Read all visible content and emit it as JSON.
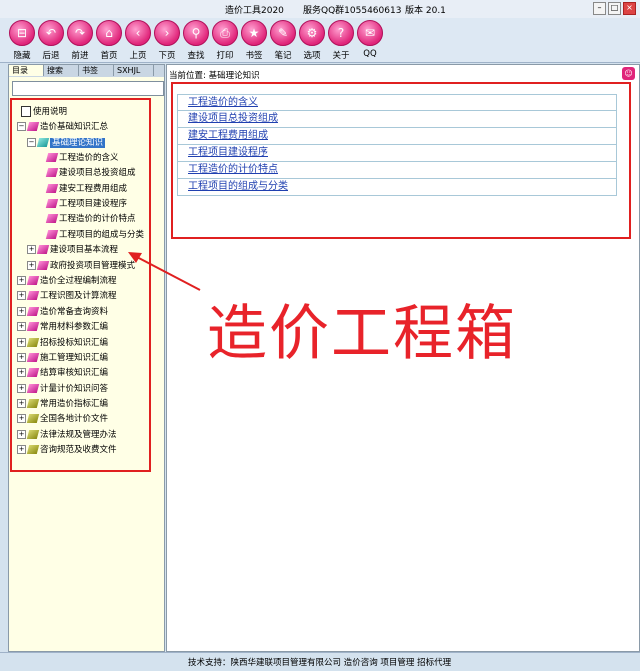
{
  "window": {
    "title": "造价工具2020",
    "service": "服务QQ群1055460613",
    "version": "版本 20.1"
  },
  "toolbar": {
    "buttons": [
      {
        "label": "隐藏",
        "icon": "hide-icon"
      },
      {
        "label": "后退",
        "icon": "back-icon"
      },
      {
        "label": "前进",
        "icon": "forward-icon"
      },
      {
        "label": "首页",
        "icon": "home-icon"
      },
      {
        "label": "上页",
        "icon": "prev-page-icon"
      },
      {
        "label": "下页",
        "icon": "next-page-icon"
      },
      {
        "label": "查找",
        "icon": "find-icon"
      },
      {
        "label": "打印",
        "icon": "print-icon"
      },
      {
        "label": "书签",
        "icon": "bookmark-icon"
      },
      {
        "label": "笔记",
        "icon": "note-icon"
      },
      {
        "label": "选项",
        "icon": "options-icon"
      },
      {
        "label": "关于",
        "icon": "about-icon"
      },
      {
        "label": "QQ",
        "icon": "qq-icon"
      }
    ]
  },
  "left_panel": {
    "tabs": [
      "目录",
      "搜索",
      "书签",
      "SXHJL"
    ],
    "search_value": "",
    "tree": [
      {
        "label": "使用说明",
        "icon": "book-icon"
      },
      {
        "label": "造价基础知识汇总",
        "icon": "folder-icon"
      },
      {
        "label": "基础理论知识",
        "icon": "folder-icon",
        "selected": true
      },
      {
        "label": "工程造价的含义",
        "icon": "page-icon"
      },
      {
        "label": "建设项目总投资组成",
        "icon": "page-icon"
      },
      {
        "label": "建安工程费用组成",
        "icon": "page-icon"
      },
      {
        "label": "工程项目建设程序",
        "icon": "page-icon"
      },
      {
        "label": "工程造价的计价特点",
        "icon": "page-icon"
      },
      {
        "label": "工程项目的组成与分类",
        "icon": "page-icon"
      },
      {
        "label": "建设项目基本流程",
        "icon": "folder-icon"
      },
      {
        "label": "政府投资项目管理模式",
        "icon": "folder-icon"
      },
      {
        "label": "造价全过程编制流程",
        "icon": "folder-icon"
      },
      {
        "label": "工程识图及计算流程",
        "icon": "folder-icon"
      },
      {
        "label": "造价常备查询资料",
        "icon": "folder-icon"
      },
      {
        "label": "常用材料参数汇编",
        "icon": "folder-icon"
      },
      {
        "label": "招标投标知识汇编",
        "icon": "folder-icon"
      },
      {
        "label": "施工管理知识汇编",
        "icon": "folder-icon"
      },
      {
        "label": "结算审核知识汇编",
        "icon": "folder-icon"
      },
      {
        "label": "计量计价知识问答",
        "icon": "folder-icon"
      },
      {
        "label": "常用造价指标汇编",
        "icon": "folder-icon"
      },
      {
        "label": "全国各地计价文件",
        "icon": "folder-icon"
      },
      {
        "label": "法律法规及管理办法",
        "icon": "folder-icon"
      },
      {
        "label": "咨询规范及收费文件",
        "icon": "folder-icon"
      }
    ]
  },
  "main": {
    "breadcrumb": "当前位置: 基础理论知识",
    "links": [
      "工程造价的含义",
      "建设项目总投资组成",
      "建安工程费用组成",
      "工程项目建设程序",
      "工程造价的计价特点",
      "工程项目的组成与分类"
    ]
  },
  "overlay": {
    "caption": "造价工程箱"
  },
  "footer": {
    "text": "技术支持：陕西华建联项目管理有限公司  造价咨询  项目管理  招标代理"
  }
}
